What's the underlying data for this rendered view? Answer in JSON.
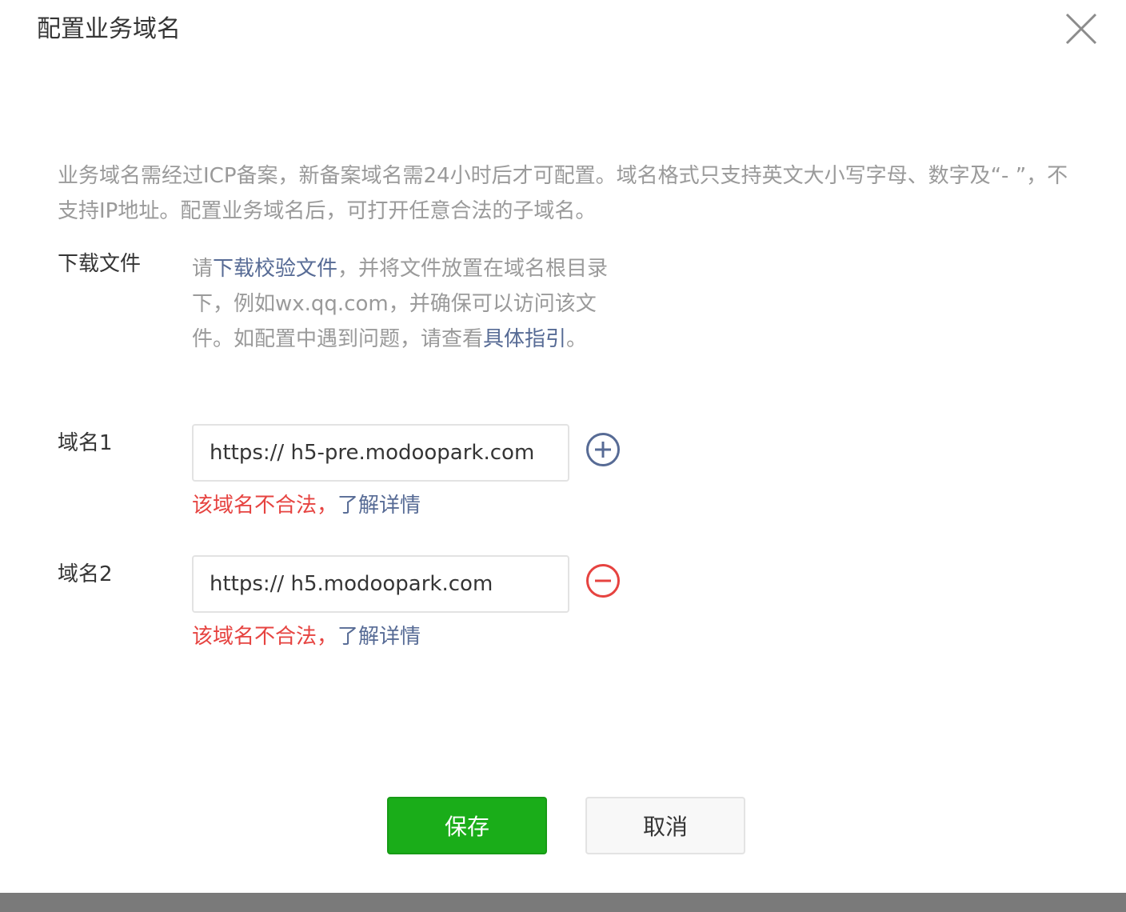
{
  "dialog": {
    "title": "配置业务域名",
    "close_icon": "close-icon"
  },
  "description": "业务域名需经过ICP备案，新备案域名需24小时后才可配置。域名格式只支持英文大小写字母、数字及“- ”，不支持IP地址。配置业务域名后，可打开任意合法的子域名。",
  "download": {
    "label": "下载文件",
    "text_before_link": "请",
    "download_link": "下载校验文件",
    "text_middle": "，并将文件放置在域名根目录下，例如wx.qq.com，并确保可以访问该文件。如配置中遇到问题，请查看",
    "guide_link": "具体指引",
    "text_end": "。"
  },
  "domains": [
    {
      "label": "域名1",
      "value": "https:// h5-pre.modoopark.com",
      "action_icon": "plus-circle-icon",
      "error_text": "该域名不合法，",
      "error_link": "了解详情"
    },
    {
      "label": "域名2",
      "value": "https:// h5.modoopark.com",
      "action_icon": "minus-circle-icon",
      "error_text": "该域名不合法，",
      "error_link": "了解详情"
    }
  ],
  "buttons": {
    "save": "保存",
    "cancel": "取消"
  },
  "colors": {
    "primary_green": "#1aad19",
    "link_blue": "#576b95",
    "error_red": "#e64340",
    "muted_text": "#9a9a9a"
  }
}
